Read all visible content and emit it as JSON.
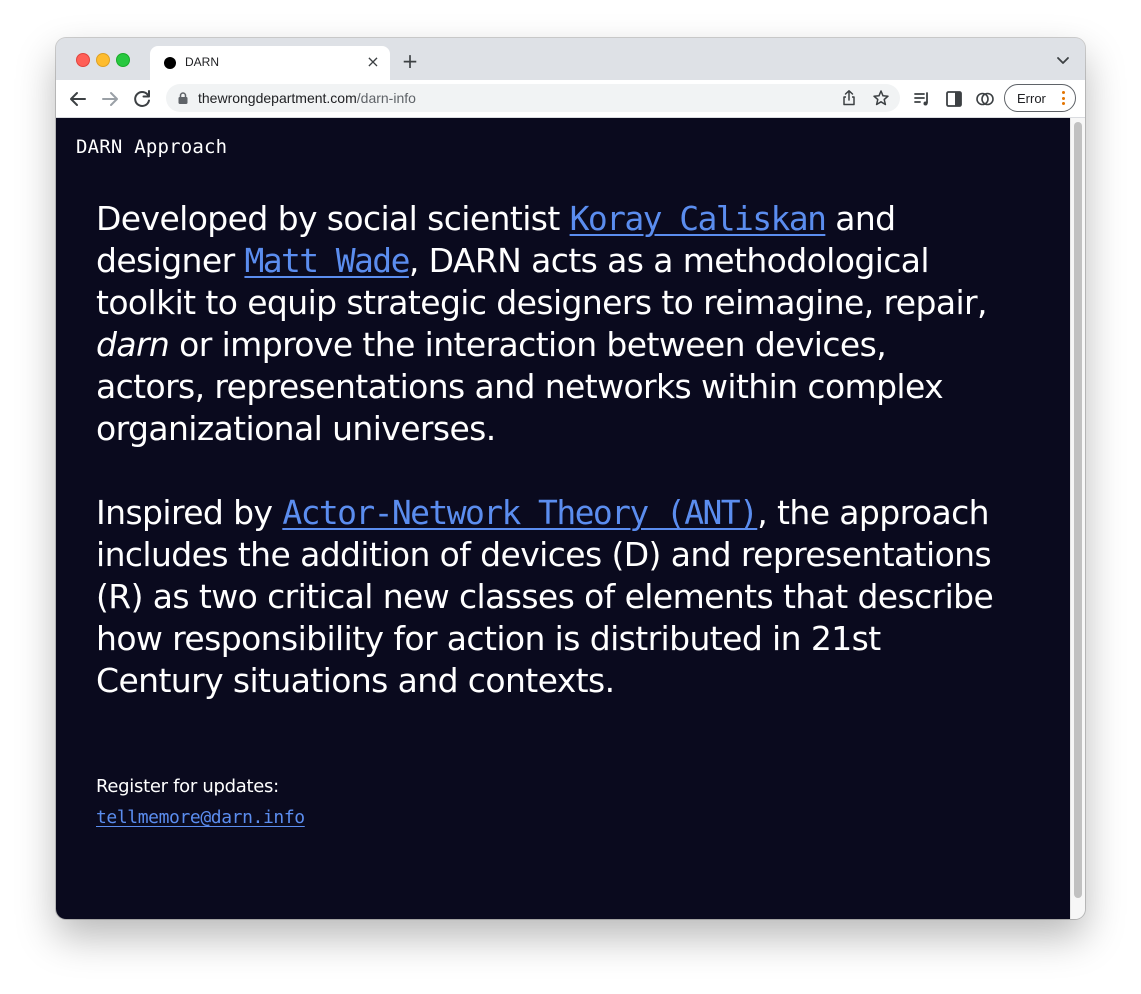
{
  "browser": {
    "tab": {
      "title": "DARN"
    },
    "omnibox": {
      "domain": "thewrongdepartment.com",
      "path": "/darn-info"
    },
    "profile_badge": {
      "label": "Error"
    }
  },
  "page": {
    "site_title": "DARN Approach",
    "paragraph1": {
      "text_a": "Developed by social scientist ",
      "link_koray": "Koray Caliskan",
      "text_b": " and designer ",
      "link_matt": "Matt Wade",
      "text_c": ", DARN acts as a methodological toolkit to equip strategic designers to reimagine, repair, ",
      "emphasis": "darn",
      "text_d": " or improve the interaction between devices, actors, representations and networks within complex organizational universes."
    },
    "paragraph2": {
      "text_a": "Inspired by ",
      "link_ant": "Actor-Network Theory (ANT)",
      "text_b": ", the approach includes the addition of devices (D) and representations (R) as two critical new classes of elements that describe how responsibility for action is distributed in 21st Century situations and contexts."
    },
    "register_label": "Register for updates:",
    "email_link": "tellmemore@darn.info"
  },
  "colors": {
    "page_background": "#0a0a1e",
    "link": "#5b8def",
    "text": "#ffffff"
  }
}
